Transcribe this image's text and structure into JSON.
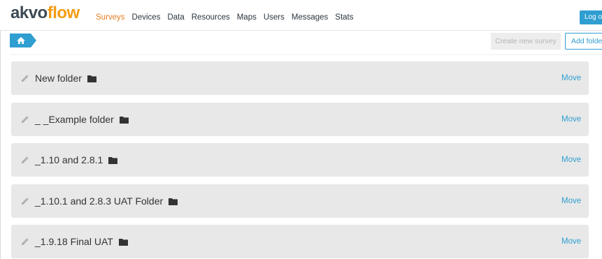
{
  "header": {
    "logo_main": "akvo",
    "logo_accent": "flow",
    "nav": [
      "Surveys",
      "Devices",
      "Data",
      "Resources",
      "Maps",
      "Users",
      "Messages",
      "Stats"
    ],
    "active_nav": "Surveys",
    "logout_label": "Log out"
  },
  "toolbar": {
    "home_icon": "home-icon",
    "create_survey_label": "Create new survey",
    "add_folder_label": "Add folder"
  },
  "folders": [
    {
      "name": "New folder",
      "action": "Move"
    },
    {
      "name": "_ _Example folder",
      "action": "Move"
    },
    {
      "name": "_1.10 and 2.8.1",
      "action": "Move"
    },
    {
      "name": "_1.10.1 and 2.8.3 UAT Folder",
      "action": "Move"
    },
    {
      "name": "_1.9.18 Final UAT",
      "action": "Move"
    }
  ],
  "colors": {
    "accent": "#2f9ed1",
    "logo_dark": "#3d4a56",
    "logo_orange": "#f39c12",
    "active_nav": "#e67e22",
    "row_bg": "#e8e8e8"
  }
}
